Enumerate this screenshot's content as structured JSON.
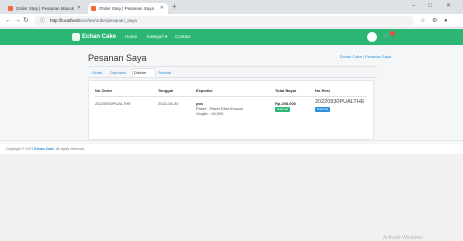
{
  "browser": {
    "tabs": [
      {
        "title": "Order Step | Pesanan Masuk"
      },
      {
        "title": "Order Step | Pesanan Saya"
      }
    ],
    "new_tab_label": "+",
    "url_host": "http://localhost",
    "url_path": "/ecc/tes/order/pesanan_saya",
    "window_controls": [
      "–",
      "□",
      "✕"
    ]
  },
  "navbar": {
    "brand": "Echan Cake",
    "links": [
      "Home",
      "Kategori ▾",
      "Contact"
    ],
    "user_label": "",
    "colors": {
      "brand": "#2bb673"
    }
  },
  "page": {
    "title": "Pesanan Saya",
    "breadcrumb": "Echan Cake  |  Pesanan Saya",
    "tabs": [
      "Order",
      "Diproses",
      "Dikirim",
      "Selesai"
    ],
    "active_tab": "Dikirim"
  },
  "table": {
    "headers": [
      "No Order",
      "Tanggal",
      "Expedisi",
      "Total Bayar",
      "No Resi"
    ],
    "rows": [
      {
        "order_no": "20220930PUALTHE",
        "date": "2022-06-30",
        "expedisi_name": "pos",
        "address_line": "Paket : Paket Kilat Khusus",
        "ongkir_line": "Ongkir : 18,000",
        "total": "Rp.298.000",
        "payment_badge": "Diterima",
        "resi": "20220930PUALTHE",
        "resi_badge": "Diterima"
      }
    ]
  },
  "footer": {
    "prefix": "Copyright © 2021 ",
    "brand": "Echan Cake",
    "suffix": ". All rights reserved."
  },
  "watermark": "Activate Windows"
}
